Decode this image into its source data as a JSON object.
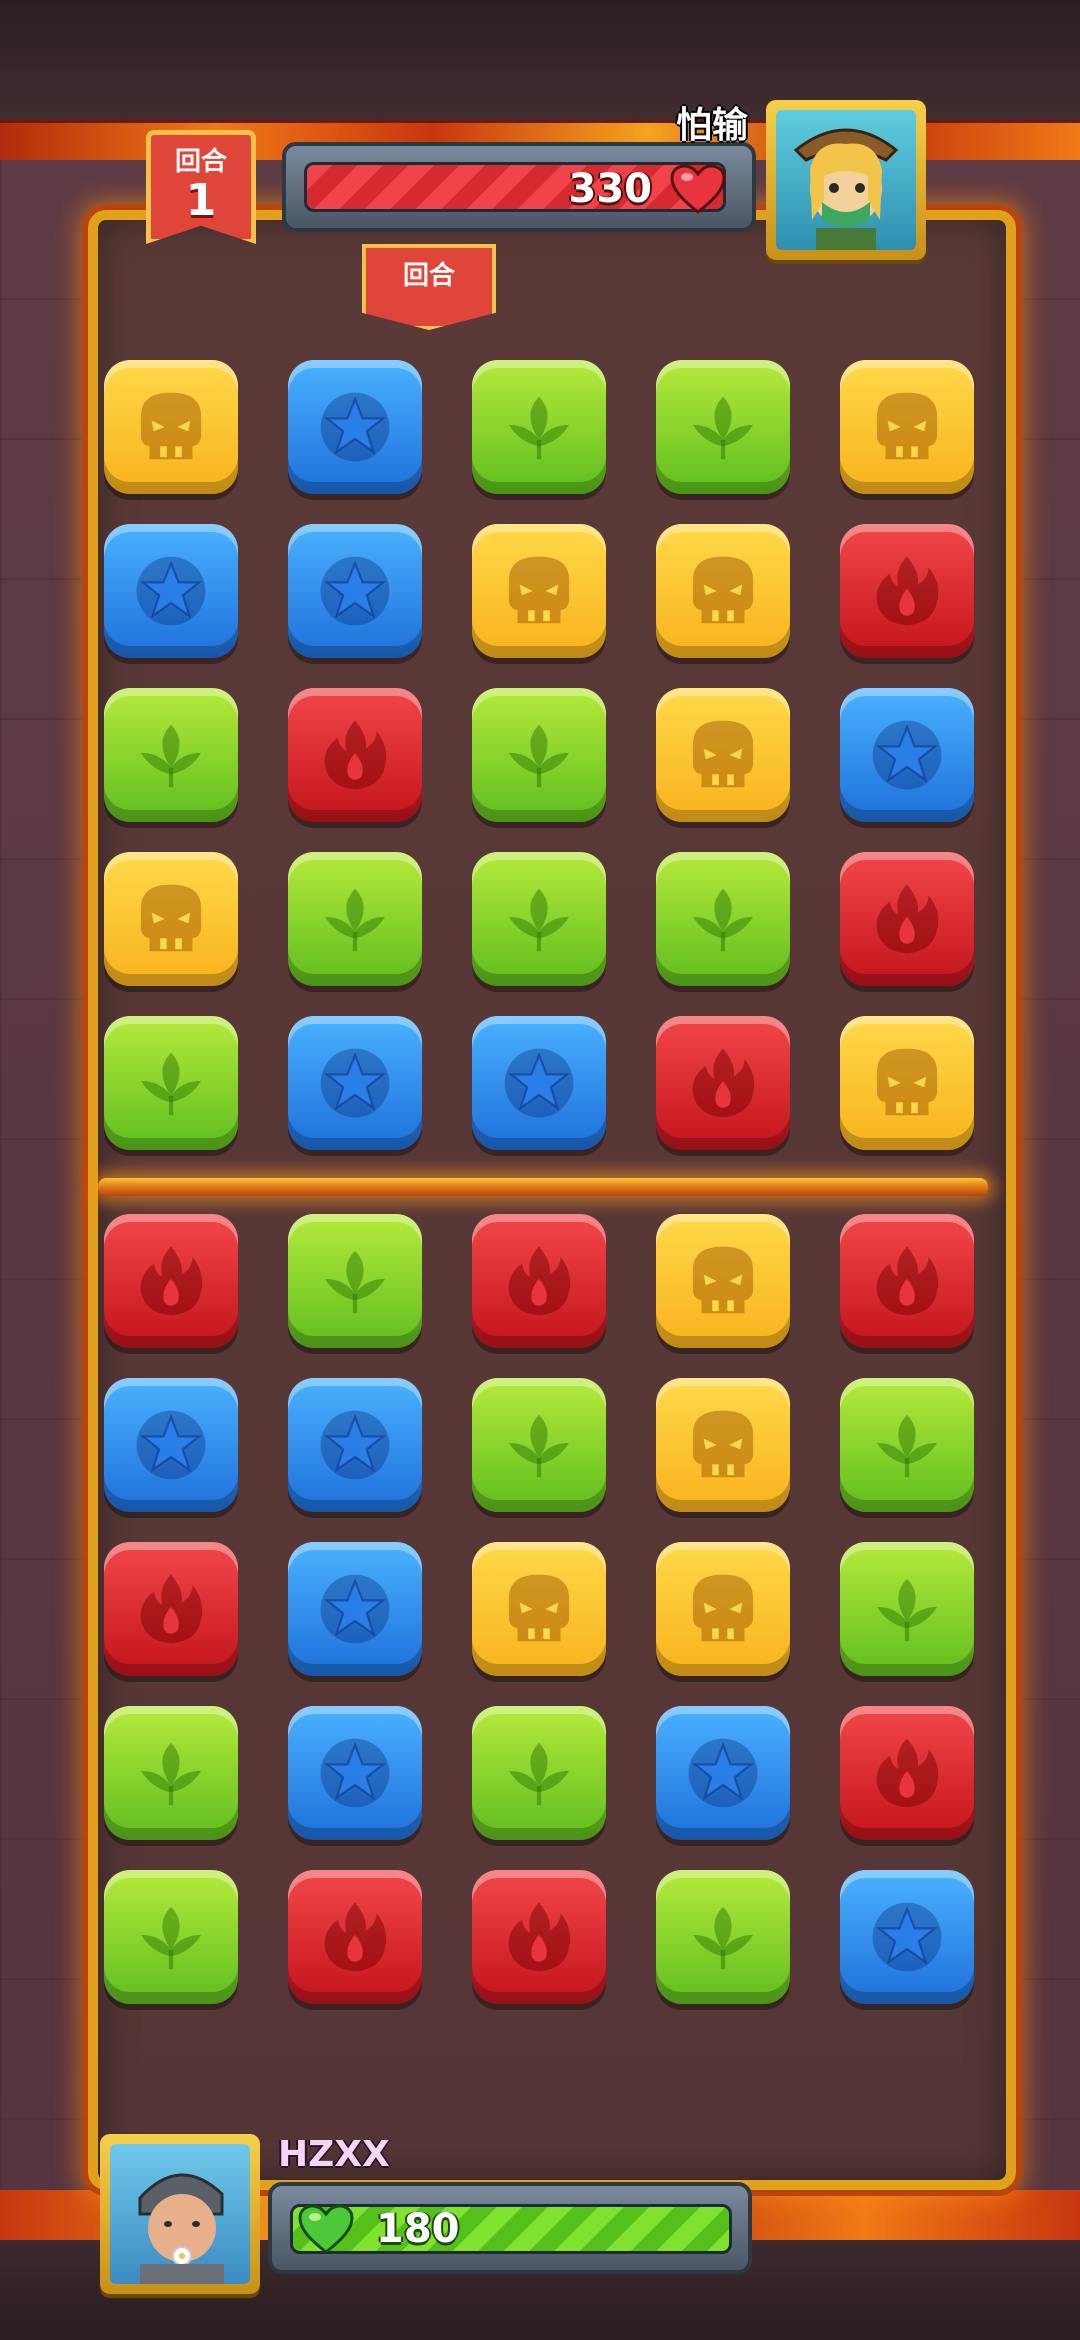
{
  "hud": {
    "round_label": "回合",
    "round_number": "1",
    "round_tag_label": "回合",
    "enemy": {
      "name": "怕输",
      "hp": "330",
      "hp_fraction": 0.96,
      "avatar_icon": "ranger-girl-avatar",
      "heart_icon": "red-heart-icon"
    },
    "player": {
      "name": "HZXX",
      "hp": "180",
      "hp_fraction": 1.0,
      "avatar_icon": "old-man-helmet-avatar",
      "heart_icon": "green-heart-icon"
    }
  },
  "colors": {
    "yellow": "#f8b21c",
    "blue": "#1e6fd9",
    "green": "#5fbd1e",
    "red": "#c3141c",
    "frame": "#e0a21a",
    "lava": "#f07a16"
  },
  "board": {
    "columns": 5,
    "tile_types": {
      "Y": "skull-icon",
      "B": "star-icon",
      "G": "leaf-icon",
      "R": "flame-icon"
    },
    "enemy_rows": [
      [
        "Y",
        "B",
        "G",
        "G",
        "Y"
      ],
      [
        "B",
        "B",
        "Y",
        "Y",
        "R"
      ],
      [
        "G",
        "R",
        "G",
        "Y",
        "B"
      ],
      [
        "Y",
        "G",
        "G",
        "G",
        "R"
      ],
      [
        "G",
        "B",
        "B",
        "R",
        "Y"
      ]
    ],
    "player_rows": [
      [
        "R",
        "G",
        "R",
        "Y",
        "R"
      ],
      [
        "B",
        "B",
        "G",
        "Y",
        "G"
      ],
      [
        "R",
        "B",
        "Y",
        "Y",
        "G"
      ],
      [
        "G",
        "B",
        "G",
        "B",
        "R"
      ],
      [
        "G",
        "R",
        "R",
        "G",
        "B"
      ]
    ]
  }
}
